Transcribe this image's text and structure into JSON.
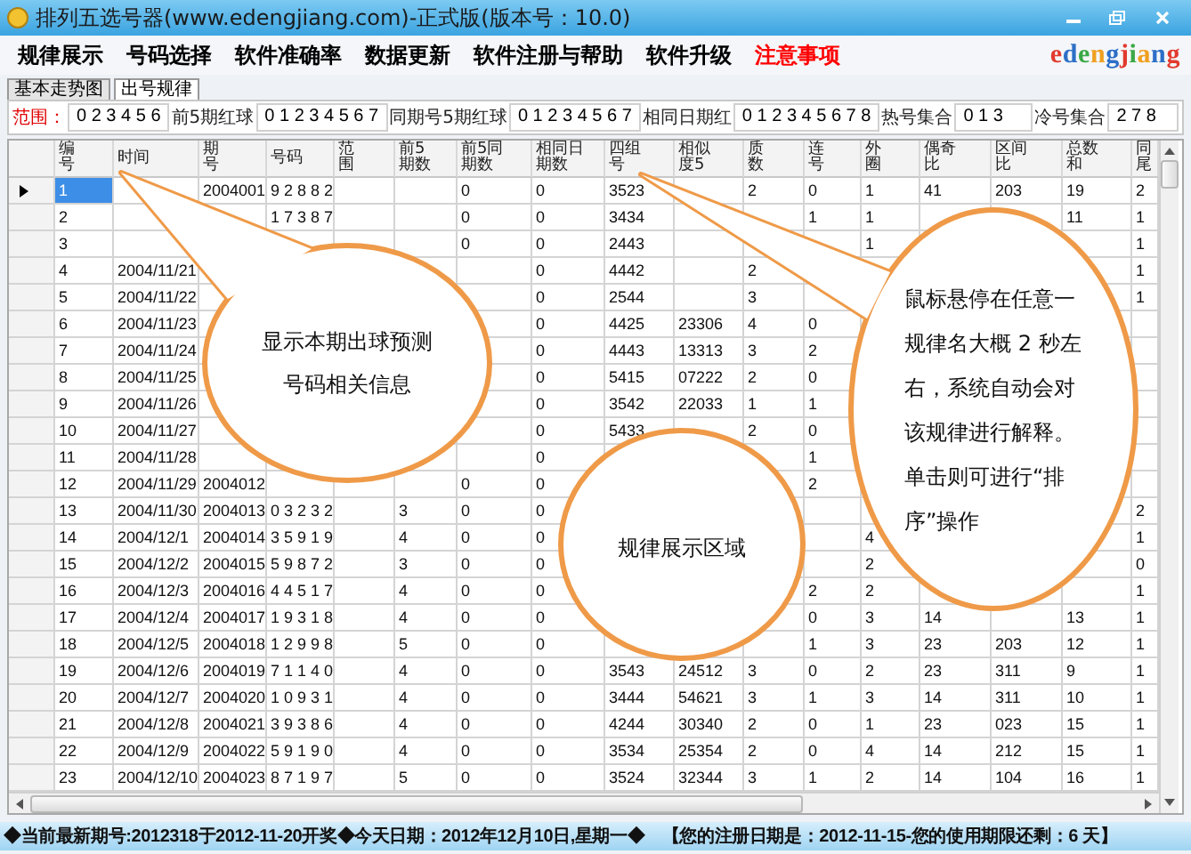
{
  "window": {
    "title": "排列五选号器(www.edengjiang.com)-正式版(版本号：10.0)"
  },
  "menu": [
    {
      "label": "规律展示",
      "color": "#000000"
    },
    {
      "label": "号码选择",
      "color": "#000000"
    },
    {
      "label": "软件准确率",
      "color": "#000000"
    },
    {
      "label": "数据更新",
      "color": "#000000"
    },
    {
      "label": "软件注册与帮助",
      "color": "#000000"
    },
    {
      "label": "软件升级",
      "color": "#000000"
    },
    {
      "label": "注意事项",
      "color": "#ff0000"
    }
  ],
  "logo": "edengjiang",
  "tabs": [
    {
      "label": "基本走势图",
      "selected": false
    },
    {
      "label": "出号规律",
      "selected": true
    }
  ],
  "filters": [
    {
      "label": "范围：",
      "value": "0 2 3 4 5 6"
    },
    {
      "label": "前5期红球",
      "value": "0 1 2 3 4 5 6 7"
    },
    {
      "label": "同期号5期红球",
      "value": "0 1 2 3 4 5 6 7"
    },
    {
      "label": "相同日期红",
      "value": "0 1 2 3 4 5 6 7 8"
    },
    {
      "label": "热号集合",
      "value": "0 1 3"
    },
    {
      "label": "冷号集合",
      "value": "2 7 8"
    }
  ],
  "table": {
    "columns": [
      "编号",
      "时间",
      "期号",
      "号码",
      "范围",
      "前5期数",
      "前5同期数",
      "相同日期数",
      "四组号",
      "相似度5",
      "质数",
      "连号",
      "外圈",
      "偶奇比",
      "区间比",
      "总数和",
      "同尾"
    ],
    "rows": [
      {
        "selected": true,
        "cells": [
          "1",
          null,
          "2004001",
          "9 2 8 8 2",
          null,
          null,
          "0",
          "0",
          "3523",
          null,
          "2",
          "0",
          "1",
          "41",
          "203",
          "19",
          "2"
        ]
      },
      {
        "selected": false,
        "cells": [
          "2",
          null,
          null,
          "1 7 3 8 7",
          null,
          null,
          "0",
          "0",
          "3434",
          null,
          null,
          "1",
          "1",
          null,
          null,
          "11",
          "1"
        ]
      },
      {
        "selected": false,
        "cells": [
          "3",
          null,
          null,
          null,
          null,
          null,
          "0",
          "0",
          "2443",
          null,
          null,
          null,
          "1",
          null,
          null,
          null,
          "1"
        ]
      },
      {
        "selected": false,
        "cells": [
          "4",
          "2004/11/21",
          null,
          null,
          null,
          null,
          null,
          "0",
          "4442",
          null,
          "2",
          null,
          null,
          null,
          null,
          null,
          "1"
        ]
      },
      {
        "selected": false,
        "cells": [
          "5",
          "2004/11/22",
          null,
          null,
          null,
          null,
          null,
          "0",
          "2544",
          null,
          "3",
          null,
          null,
          null,
          null,
          null,
          "1"
        ]
      },
      {
        "selected": false,
        "cells": [
          "6",
          "2004/11/23",
          null,
          null,
          null,
          null,
          null,
          "0",
          "4425",
          "23306",
          "4",
          "0",
          null,
          null,
          null,
          null,
          null
        ]
      },
      {
        "selected": false,
        "cells": [
          "7",
          "2004/11/24",
          null,
          null,
          null,
          null,
          null,
          "0",
          "4443",
          "13313",
          "3",
          "2",
          null,
          null,
          null,
          null,
          null
        ]
      },
      {
        "selected": false,
        "cells": [
          "8",
          "2004/11/25",
          null,
          null,
          null,
          null,
          null,
          "0",
          "5415",
          "07222",
          "2",
          "0",
          null,
          null,
          null,
          null,
          null
        ]
      },
      {
        "selected": false,
        "cells": [
          "9",
          "2004/11/26",
          null,
          null,
          null,
          null,
          null,
          "0",
          "3542",
          "22033",
          "1",
          "1",
          null,
          null,
          null,
          null,
          null
        ]
      },
      {
        "selected": false,
        "cells": [
          "10",
          "2004/11/27",
          null,
          null,
          null,
          null,
          null,
          "0",
          "5433",
          null,
          "2",
          "0",
          null,
          null,
          null,
          null,
          null
        ]
      },
      {
        "selected": false,
        "cells": [
          "11",
          "2004/11/28",
          null,
          null,
          null,
          null,
          null,
          "0",
          null,
          null,
          null,
          "1",
          null,
          null,
          null,
          null,
          null
        ]
      },
      {
        "selected": false,
        "cells": [
          "12",
          "2004/11/29",
          "2004012",
          null,
          null,
          null,
          "0",
          "0",
          null,
          null,
          null,
          "2",
          null,
          null,
          null,
          null,
          null
        ]
      },
      {
        "selected": false,
        "cells": [
          "13",
          "2004/11/30",
          "2004013",
          "0 3 2 3 2",
          null,
          "3",
          "0",
          "0",
          null,
          null,
          null,
          null,
          null,
          null,
          null,
          null,
          "2"
        ]
      },
      {
        "selected": false,
        "cells": [
          "14",
          "2004/12/1",
          "2004014",
          "3 5 9 1 9",
          null,
          "4",
          "0",
          "0",
          null,
          null,
          null,
          null,
          "4",
          null,
          null,
          null,
          "1"
        ]
      },
      {
        "selected": false,
        "cells": [
          "15",
          "2004/12/2",
          "2004015",
          "5 9 8 7 2",
          null,
          "3",
          "0",
          "0",
          null,
          null,
          null,
          null,
          "2",
          null,
          null,
          null,
          "0"
        ]
      },
      {
        "selected": false,
        "cells": [
          "16",
          "2004/12/3",
          "2004016",
          "4 4 5 1 7",
          null,
          "4",
          "0",
          "0",
          null,
          null,
          null,
          "2",
          "2",
          null,
          null,
          null,
          "1"
        ]
      },
      {
        "selected": false,
        "cells": [
          "17",
          "2004/12/4",
          "2004017",
          "1 9 3 1 8",
          null,
          "4",
          "0",
          "0",
          null,
          null,
          null,
          "0",
          "3",
          "14",
          null,
          "13",
          "1"
        ]
      },
      {
        "selected": false,
        "cells": [
          "18",
          "2004/12/5",
          "2004018",
          "1 2 9 9 8",
          null,
          "5",
          "0",
          "0",
          null,
          null,
          null,
          "1",
          "3",
          "23",
          "203",
          "12",
          "1"
        ]
      },
      {
        "selected": false,
        "cells": [
          "19",
          "2004/12/6",
          "2004019",
          "7 1 1 4 0",
          null,
          "4",
          "0",
          "0",
          "3543",
          "24512",
          "3",
          "0",
          "2",
          "23",
          "311",
          "9",
          "1"
        ]
      },
      {
        "selected": false,
        "cells": [
          "20",
          "2004/12/7",
          "2004020",
          "1 0 9 3 1",
          null,
          "4",
          "0",
          "0",
          "3444",
          "54621",
          "3",
          "1",
          "3",
          "14",
          "311",
          "10",
          "1"
        ]
      },
      {
        "selected": false,
        "cells": [
          "21",
          "2004/12/8",
          "2004021",
          "3 9 3 8 6",
          null,
          "4",
          "0",
          "0",
          "4244",
          "30340",
          "2",
          "0",
          "1",
          "23",
          "023",
          "15",
          "1"
        ]
      },
      {
        "selected": false,
        "cells": [
          "22",
          "2004/12/9",
          "2004022",
          "5 9 1 9 0",
          null,
          "4",
          "0",
          "0",
          "3534",
          "25354",
          "2",
          "0",
          "4",
          "14",
          "212",
          "15",
          "1"
        ]
      },
      {
        "selected": false,
        "cells": [
          "23",
          "2004/12/10",
          "2004023",
          "8 7 1 9 7",
          null,
          "5",
          "0",
          "0",
          "3524",
          "32344",
          "3",
          "1",
          "2",
          "14",
          "104",
          "16",
          "1"
        ]
      }
    ]
  },
  "callouts": [
    {
      "text": "显示本期出球预测号码相关信息"
    },
    {
      "text": "规律展示区域"
    },
    {
      "text": "鼠标悬停在任意一规律名大概 2 秒左右，系统自动会对该规律进行解释。单击则可进行“排序”操作"
    }
  ],
  "status_bar": "◆当前最新期号:2012318于2012-11-20开奖◆今天日期：2012年12月10日,星期一◆　【您的注册日期是：2012-11-15-您的使用期限还剩：6 天】"
}
